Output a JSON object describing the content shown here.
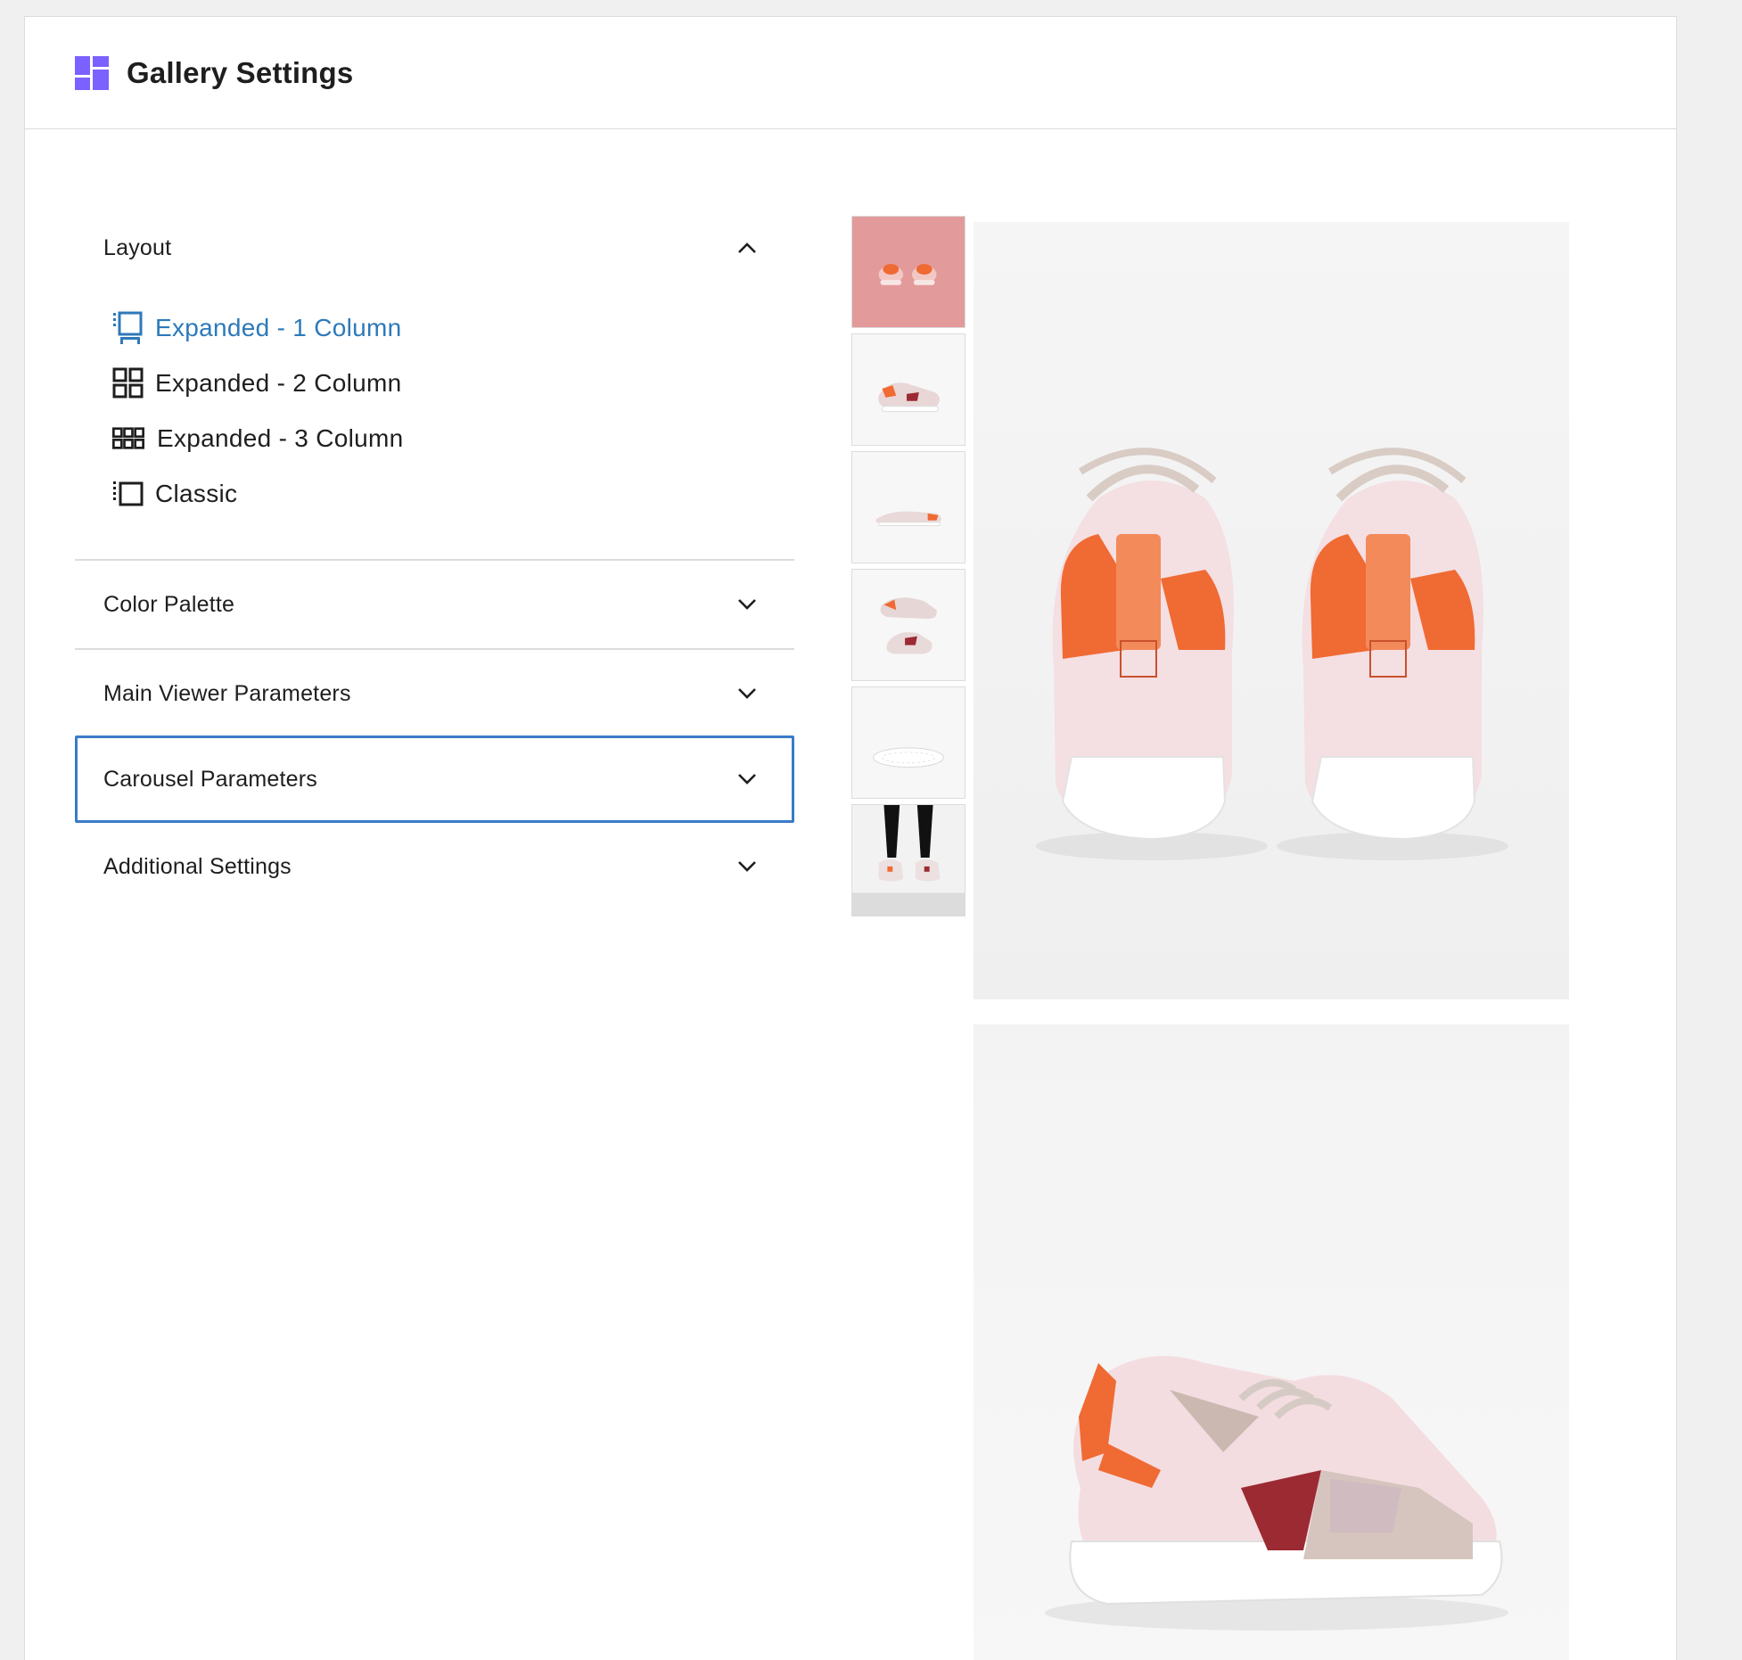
{
  "header": {
    "title": "Gallery Settings",
    "icon": "gallery-grid-icon",
    "icon_color": "#7b61ff"
  },
  "sections": {
    "layout": {
      "label": "Layout",
      "expanded": true,
      "options": [
        {
          "label": "Expanded - 1 Column",
          "icon": "expanded-1-column-icon",
          "active": true
        },
        {
          "label": "Expanded - 2 Column",
          "icon": "expanded-2-column-icon",
          "active": false
        },
        {
          "label": "Expanded - 3 Column",
          "icon": "expanded-3-column-icon",
          "active": false
        },
        {
          "label": "Classic",
          "icon": "classic-layout-icon",
          "active": false
        }
      ]
    },
    "color_palette": {
      "label": "Color Palette",
      "expanded": false
    },
    "main_viewer": {
      "label": "Main Viewer Parameters",
      "expanded": false
    },
    "carousel": {
      "label": "Carousel Parameters",
      "expanded": false,
      "focused": true
    },
    "additional": {
      "label": "Additional Settings",
      "expanded": false
    }
  },
  "colors": {
    "accent": "#2e79b9",
    "focus_border": "#3a7bc8",
    "brand": "#7b61ff"
  },
  "gallery": {
    "thumbnail_count": 6,
    "main_image_count": 2
  }
}
